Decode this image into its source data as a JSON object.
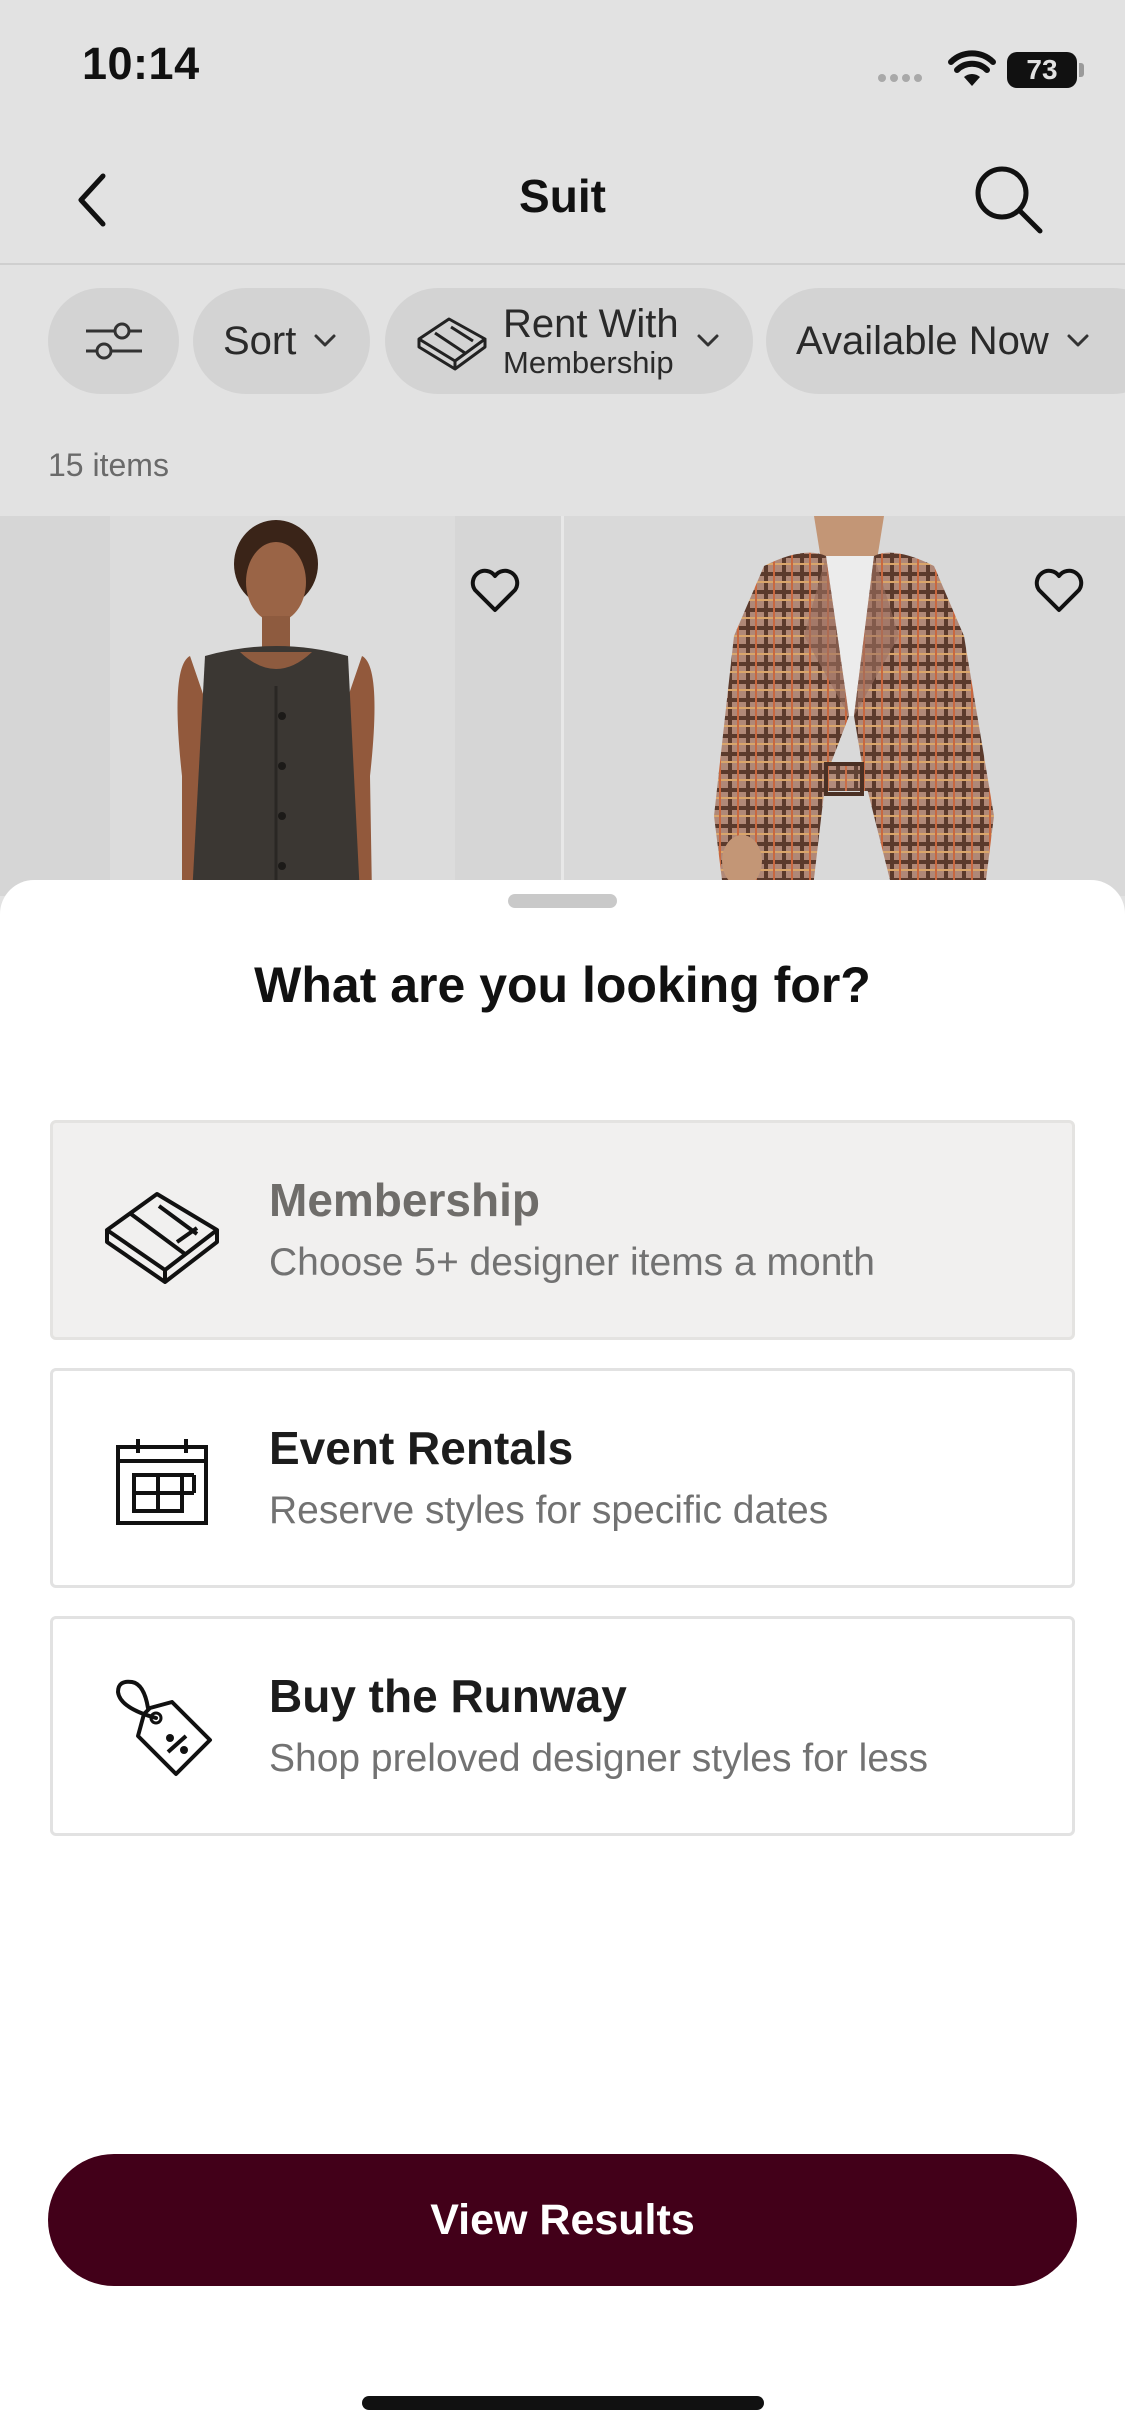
{
  "status_bar": {
    "time": "10:14",
    "battery": "73"
  },
  "nav": {
    "title": "Suit",
    "back_icon": "chevron-left-icon",
    "search_icon": "search-icon"
  },
  "filters": {
    "sort_label": "Sort",
    "rent_label": "Rent With",
    "rent_sublabel": "Membership",
    "available_label": "Available Now"
  },
  "results": {
    "count_label": "15 items"
  },
  "sheet": {
    "title": "What are you looking for?",
    "options": [
      {
        "title": "Membership",
        "description": "Choose 5+ designer items a month",
        "icon": "membership-box-icon",
        "selected": true
      },
      {
        "title": "Event Rentals",
        "description": "Reserve styles for specific dates",
        "icon": "calendar-icon",
        "selected": false
      },
      {
        "title": "Buy the Runway",
        "description": "Shop preloved designer styles for less",
        "icon": "price-tag-icon",
        "selected": false
      }
    ],
    "cta_label": "View Results"
  },
  "colors": {
    "cta": "#420019",
    "selected_card": "#f1f0ef",
    "dim_background": "#e2e2e2"
  }
}
